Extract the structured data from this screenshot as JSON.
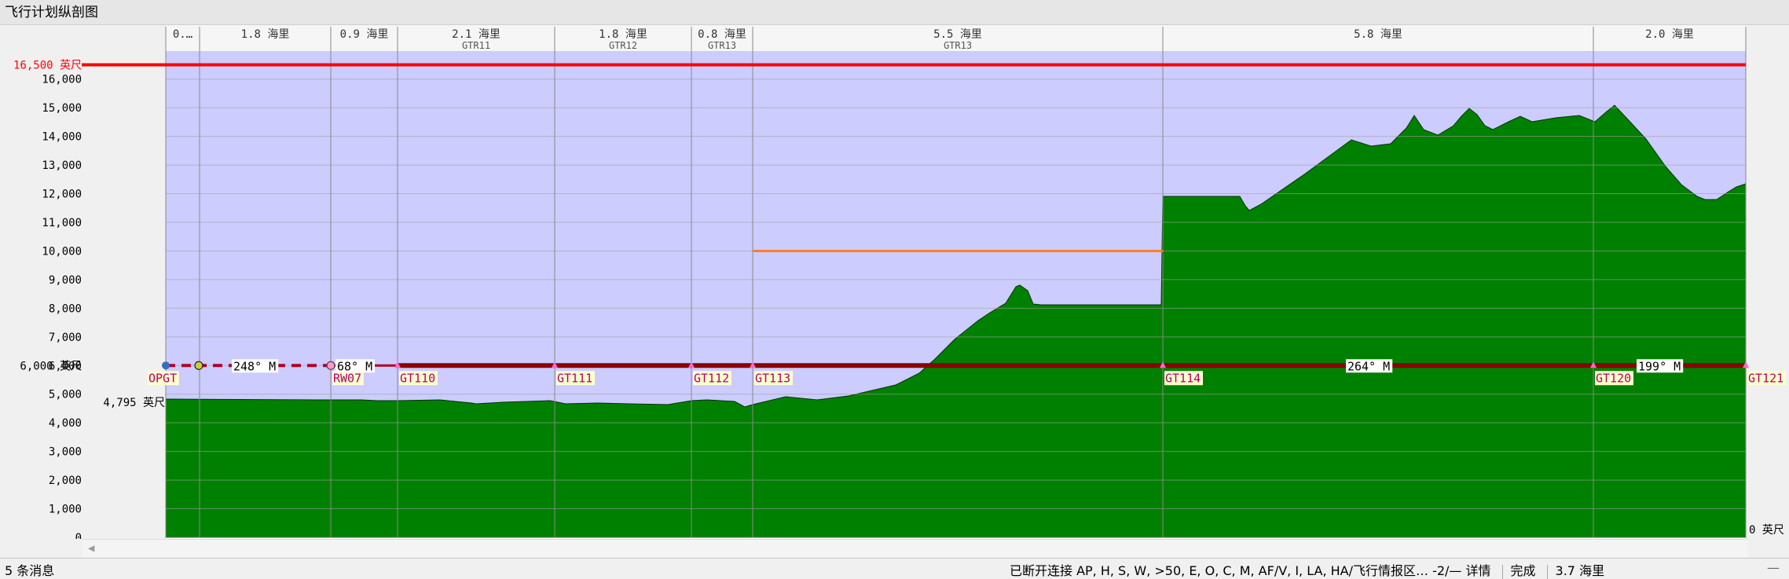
{
  "window": {
    "title": "飞行计划纵剖图"
  },
  "chart_data": {
    "type": "area",
    "y_ticks": [
      "0",
      "1,000",
      "2,000",
      "3,000",
      "4,000",
      "5,000",
      "6,000",
      "7,000",
      "8,000",
      "9,000",
      "10,000",
      "11,000",
      "12,000",
      "13,000",
      "14,000",
      "15,000",
      "16,000"
    ],
    "ylim": [
      0,
      16500
    ],
    "ceiling": {
      "value": 16500,
      "label": "16,500 英尺",
      "color": "#ff0000"
    },
    "cruise": {
      "value": 6000,
      "label": "6,000 英尺"
    },
    "min_alt": {
      "value": 4795,
      "label": "4,795 英尺"
    },
    "zero_label": "0 英尺",
    "segments": [
      {
        "dist": "0.…",
        "airway": ""
      },
      {
        "dist": "1.8 海里",
        "airway": ""
      },
      {
        "dist": "0.9 海里",
        "airway": ""
      },
      {
        "dist": "2.1 海里",
        "airway": "GTR11"
      },
      {
        "dist": "1.8 海里",
        "airway": "GTR12"
      },
      {
        "dist": "0.8 海里",
        "airway": "GTR13"
      },
      {
        "dist": "5.5 海里",
        "airway": "GTR13"
      },
      {
        "dist": "5.8 海里",
        "airway": ""
      },
      {
        "dist": "2.0 海里",
        "airway": ""
      }
    ],
    "waypoints": [
      "OPGT",
      "RW07",
      "GT110",
      "GT111",
      "GT112",
      "GT113",
      "GT114",
      "GT120",
      "GT121"
    ],
    "headings": [
      "248° M",
      "68° M",
      "264° M",
      "199° M"
    ],
    "orange_limit": {
      "value": 10000,
      "color": "#ff7f27"
    },
    "colors": {
      "sky": "#ccccff",
      "terrain": "#008000",
      "route": "#8b0000",
      "grid": "#a0a0a0"
    }
  },
  "status": {
    "messages": "5 条消息",
    "connection": "已断开连接 AP, H, S, W, >50, E, O, C, M, AF/V, I, LA, HA/飞行情报区… -2/— 详情",
    "done": "完成",
    "distance": "3.7 海里"
  }
}
